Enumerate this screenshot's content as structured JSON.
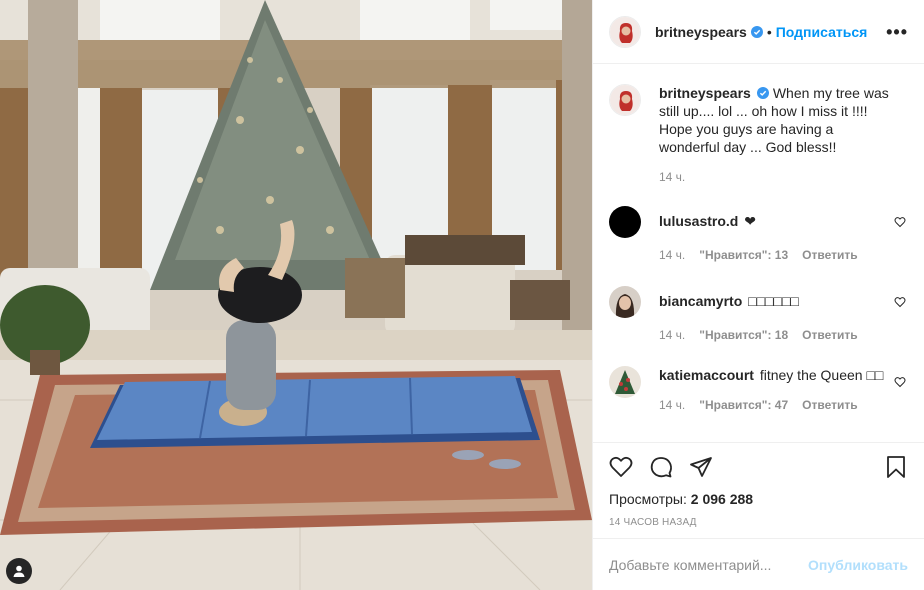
{
  "post": {
    "author": "britneyspears",
    "follow_label": "Подписаться",
    "more_label": "•••",
    "dot": "•"
  },
  "caption": {
    "user": "britneyspears",
    "text": "When my tree was still up.... lol ... oh how I miss it !!!! Hope you guys are having a wonderful day ... God bless!!",
    "time": "14 ч."
  },
  "comments": [
    {
      "user": "lulusastro.d",
      "text": "❤",
      "time": "14 ч.",
      "likes": "\"Нравится\": 13",
      "reply": "Ответить"
    },
    {
      "user": "biancamyrto",
      "text": "□□□□□□",
      "time": "14 ч.",
      "likes": "\"Нравится\": 18",
      "reply": "Ответить"
    },
    {
      "user": "katiemaccourt",
      "text": "fitney the Queen □□",
      "time": "14 ч.",
      "likes": "\"Нравится\": 47",
      "reply": "Ответить"
    }
  ],
  "stats": {
    "views_label": "Просмотры:",
    "views_value": "2 096 288",
    "time_ago": "14 ЧАСОВ НАЗАД"
  },
  "composer": {
    "placeholder": "Добавьте комментарий...",
    "post_label": "Опубликовать"
  },
  "icons": {
    "verified": "verified-badge-icon",
    "like": "heart-icon",
    "comment": "comment-bubble-icon",
    "share": "paper-plane-icon",
    "save": "bookmark-icon",
    "tag": "user-tag-icon"
  },
  "colors": {
    "accent": "#0095f6",
    "text": "#262626",
    "muted": "#8e8e8e",
    "post_disabled": "#b2dffc"
  }
}
